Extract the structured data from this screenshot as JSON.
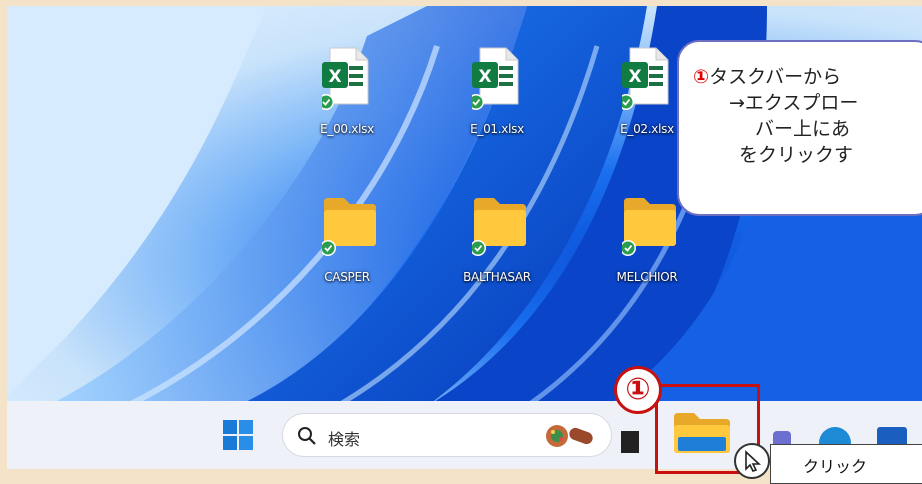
{
  "desktop": {
    "icons": [
      {
        "label": "E_00.xlsx",
        "type": "excel"
      },
      {
        "label": "E_01.xlsx",
        "type": "excel"
      },
      {
        "label": "E_02.xlsx",
        "type": "excel"
      },
      {
        "label": "CASPER",
        "type": "folder"
      },
      {
        "label": "BALTHASAR",
        "type": "folder"
      },
      {
        "label": "MELCHIOR",
        "type": "folder"
      }
    ]
  },
  "callout": {
    "number": "①",
    "line1": "タスクバーから",
    "line2": "→エクスプロー",
    "line3": "バー上にあ",
    "line4": "をクリックす"
  },
  "taskbar": {
    "search_placeholder": "検索",
    "step_marker": "①",
    "tooltip_text": "クリック"
  },
  "colors": {
    "highlight": "#c81010",
    "callout_border": "#6d6fc0",
    "taskbar_bg": "#eef1f7"
  }
}
